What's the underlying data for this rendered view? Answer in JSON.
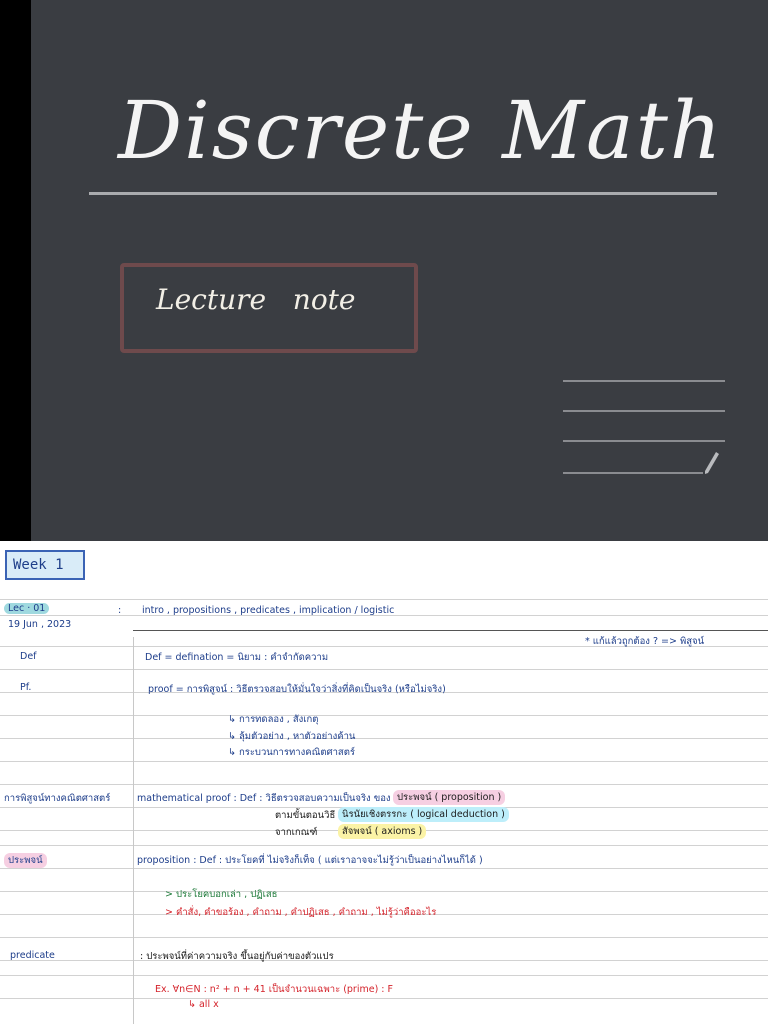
{
  "cover": {
    "title": "Discrete Math",
    "subtitle": "Lecture   note"
  },
  "notes": {
    "week": "Week 1",
    "lec": "Lec · 01",
    "date": "19 Jun , 2023",
    "colon1": ":",
    "topics": "intro , propositions , predicates , implication / logistic",
    "question": "* แก้แล้วถูกต้อง ?   =>   พิสูจน์",
    "def_label": "Def",
    "def_text": "Def  =  defination  =  นิยาม   :  คำจำกัดความ",
    "pf_label": "Pf.",
    "proof_text": "proof  =  การพิสูจน์  :  วิธีตรวจสอบให้มั่นใจว่าสิ่งที่คิดเป็นจริง (หรือไม่จริง)",
    "proof_sub1": "↳ การทดลอง , สังเกตุ",
    "proof_sub2": "↳ ลุ้มตัวอย่าง , หาตัวอย่างค้าน",
    "proof_sub3": "↳ กระบวนการทางคณิตศาสตร์",
    "math_proof_label": "การพิสูจน์ทางคณิตศาสตร์",
    "math_proof_text": "mathematical  proof :  Def   :  วิธีตรวจสอบความเป็นจริง ของ",
    "math_proof_hl1": "ประพจน์  ( proposition )",
    "math_proof_line2": "ตามขั้นตอนวิธี",
    "math_proof_hl2": "นิรนัยเชิงตรรกะ  ( logical deduction )",
    "math_proof_line3": "จากเกณฑ์",
    "math_proof_hl3": "สัจพจน์  ( axioms )",
    "prop_label": "ประพจน์",
    "prop_text": "proposition : Def    :   ประโยคที่ ไม่จริงก็เท็จ  ( แต่เราอาจจะไม่รู้ว่าเป็นอย่างไหนก็ได้ )",
    "prop_sub1": "> ประโยคบอกเล่า , ปฏิเสธ",
    "prop_sub2": "> คำสั่ง, คำขอร้อง , คำถาม , คำปฏิเสธ , คำถาม , ไม่รู้ว่าคืออะไร",
    "pred_label": "predicate",
    "pred_text": ":  ประพจน์ที่ค่าความจริง ขึ้นอยู่กับค่าของตัวแปร",
    "ex_text": "Ex.    ∀n∈N  :  n² + n + 41   เป็นจำนวนเฉพาะ (prime)        :  F",
    "ex_sub": "↳ all x"
  },
  "colors": {
    "cover_bg": "#3a3d42",
    "box_border": "#6e4a4c",
    "ink_blue": "#1d3d8a",
    "ink_green": "#1e7a3a",
    "ink_red": "#d4232b"
  }
}
